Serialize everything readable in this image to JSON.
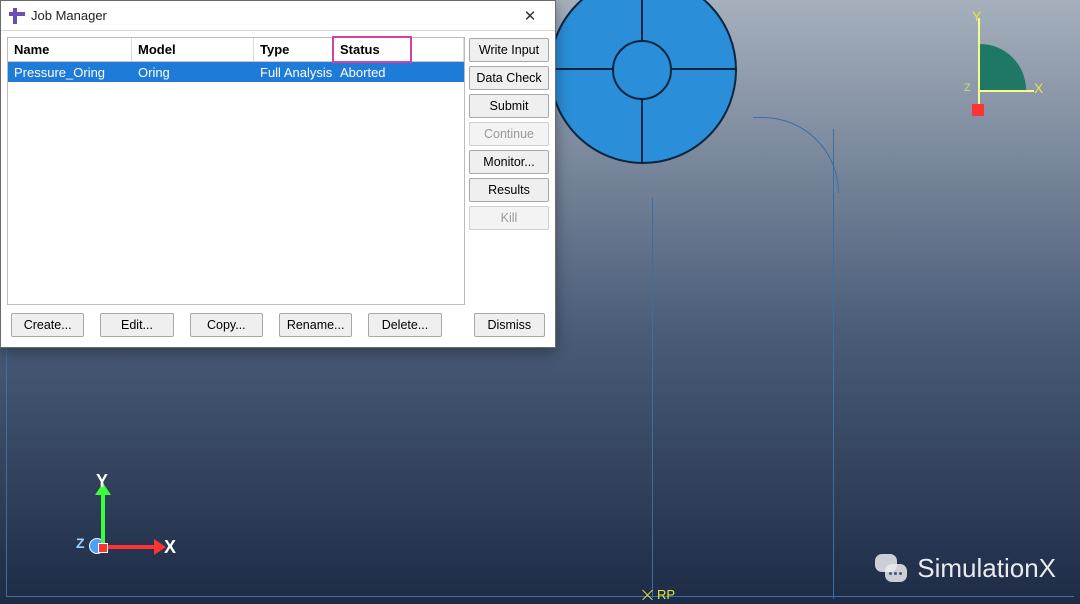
{
  "dialog": {
    "title": "Job Manager",
    "columns": {
      "name": "Name",
      "model": "Model",
      "type": "Type",
      "status": "Status"
    },
    "rows": [
      {
        "name": "Pressure_Oring",
        "model": "Oring",
        "type": "Full Analysis",
        "status": "Aborted"
      }
    ],
    "side_buttons": {
      "write_input": "Write Input",
      "data_check": "Data Check",
      "submit": "Submit",
      "continue": "Continue",
      "monitor": "Monitor...",
      "results": "Results",
      "kill": "Kill"
    },
    "footer": {
      "create": "Create...",
      "edit": "Edit...",
      "copy": "Copy...",
      "rename": "Rename...",
      "delete": "Delete...",
      "dismiss": "Dismiss"
    }
  },
  "viewport": {
    "rp_label": "RP",
    "triad": {
      "x": "X",
      "y": "Y",
      "z": "Z"
    },
    "mini_triad": {
      "x": "X",
      "y": "Y",
      "z": "Z"
    }
  },
  "watermark": {
    "text": "SimulationX"
  }
}
